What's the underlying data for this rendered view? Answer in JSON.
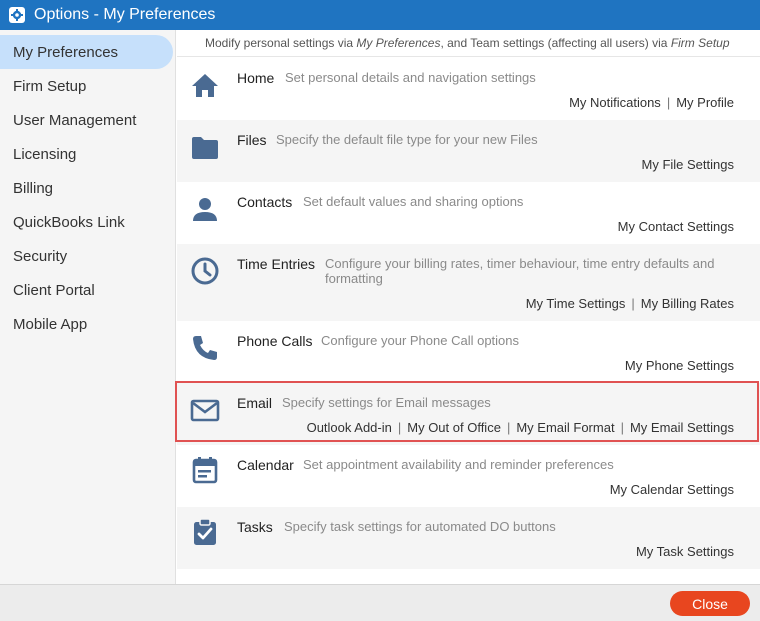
{
  "window": {
    "title": "Options - My Preferences",
    "title_icon": "gear-icon"
  },
  "sidebar": {
    "items": [
      {
        "label": "My Preferences",
        "active": true
      },
      {
        "label": "Firm Setup"
      },
      {
        "label": "User Management"
      },
      {
        "label": "Licensing"
      },
      {
        "label": "Billing"
      },
      {
        "label": "QuickBooks Link"
      },
      {
        "label": "Security"
      },
      {
        "label": "Client Portal"
      },
      {
        "label": "Mobile App"
      }
    ]
  },
  "intro": {
    "text_prefix": "Modify personal settings via ",
    "link1": "My Preferences",
    "text_middle": ", and Team settings (affecting all users) via ",
    "link2": "Firm Setup"
  },
  "rows": [
    {
      "icon": "home-icon",
      "title": "Home",
      "desc": "Set personal details and navigation settings",
      "links": [
        "My Notifications",
        "My Profile"
      ]
    },
    {
      "icon": "folder-icon",
      "title": "Files",
      "desc": "Specify the default file type for your new Files",
      "links": [
        "My File Settings"
      ]
    },
    {
      "icon": "person-icon",
      "title": "Contacts",
      "desc": "Set default values and sharing options",
      "links": [
        "My Contact Settings"
      ]
    },
    {
      "icon": "clock-icon",
      "title": "Time Entries",
      "desc": "Configure your billing rates, timer behaviour, time entry defaults and formatting",
      "links": [
        "My Time Settings",
        "My Billing Rates"
      ]
    },
    {
      "icon": "phone-icon",
      "title": "Phone Calls",
      "desc": "Configure your Phone Call options",
      "links": [
        "My Phone Settings"
      ]
    },
    {
      "icon": "mail-icon",
      "title": "Email",
      "desc": "Specify settings for Email messages",
      "links": [
        "Outlook Add-in",
        "My Out of Office",
        "My Email Format",
        "My Email Settings"
      ]
    },
    {
      "icon": "calendar-icon",
      "title": "Calendar",
      "desc": "Set appointment availability and reminder preferences",
      "links": [
        "My Calendar Settings"
      ]
    },
    {
      "icon": "clipboard-check-icon",
      "title": "Tasks",
      "desc": "Specify task settings for automated DO buttons",
      "links": [
        "My Task Settings"
      ]
    }
  ],
  "footer": {
    "close_label": "Close"
  },
  "colors": {
    "titlebar": "#1f74c1",
    "active_nav": "#c6e0fb",
    "icon": "#4a6a92",
    "highlight_border": "#e05252",
    "close_button": "#e8461f"
  }
}
